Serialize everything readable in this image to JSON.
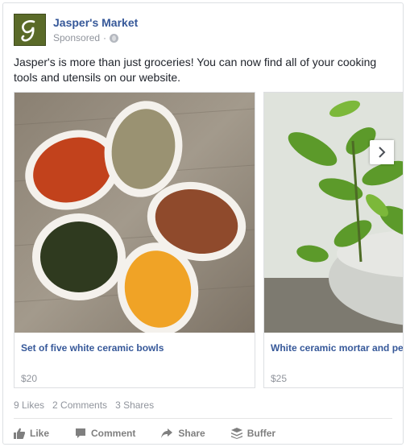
{
  "post": {
    "page_name": "Jasper's Market",
    "sponsored_label": "Sponsored",
    "separator": "·",
    "text": "Jasper's is more than just groceries! You can now find all of your cooking tools and utensils on our website."
  },
  "carousel": {
    "items": [
      {
        "title": "Set of five white ceramic bowls",
        "price": "$20",
        "image": "spice-bowls-image"
      },
      {
        "title": "White ceramic mortar and pes",
        "price": "$25",
        "image": "mortar-with-herbs-image"
      }
    ],
    "next_icon": "chevron-right-icon"
  },
  "stats": {
    "likes": "9 Likes",
    "comments": "2 Comments",
    "shares": "3 Shares"
  },
  "actions": [
    {
      "label": "Like",
      "icon": "thumbs-up-icon"
    },
    {
      "label": "Comment",
      "icon": "speech-bubble-icon"
    },
    {
      "label": "Share",
      "icon": "share-arrow-icon"
    },
    {
      "label": "Buffer",
      "icon": "buffer-layers-icon"
    }
  ],
  "colors": {
    "link_blue": "#365899",
    "meta_gray": "#90949c",
    "action_gray": "#7f7f7f",
    "border": "#dddfe2"
  }
}
